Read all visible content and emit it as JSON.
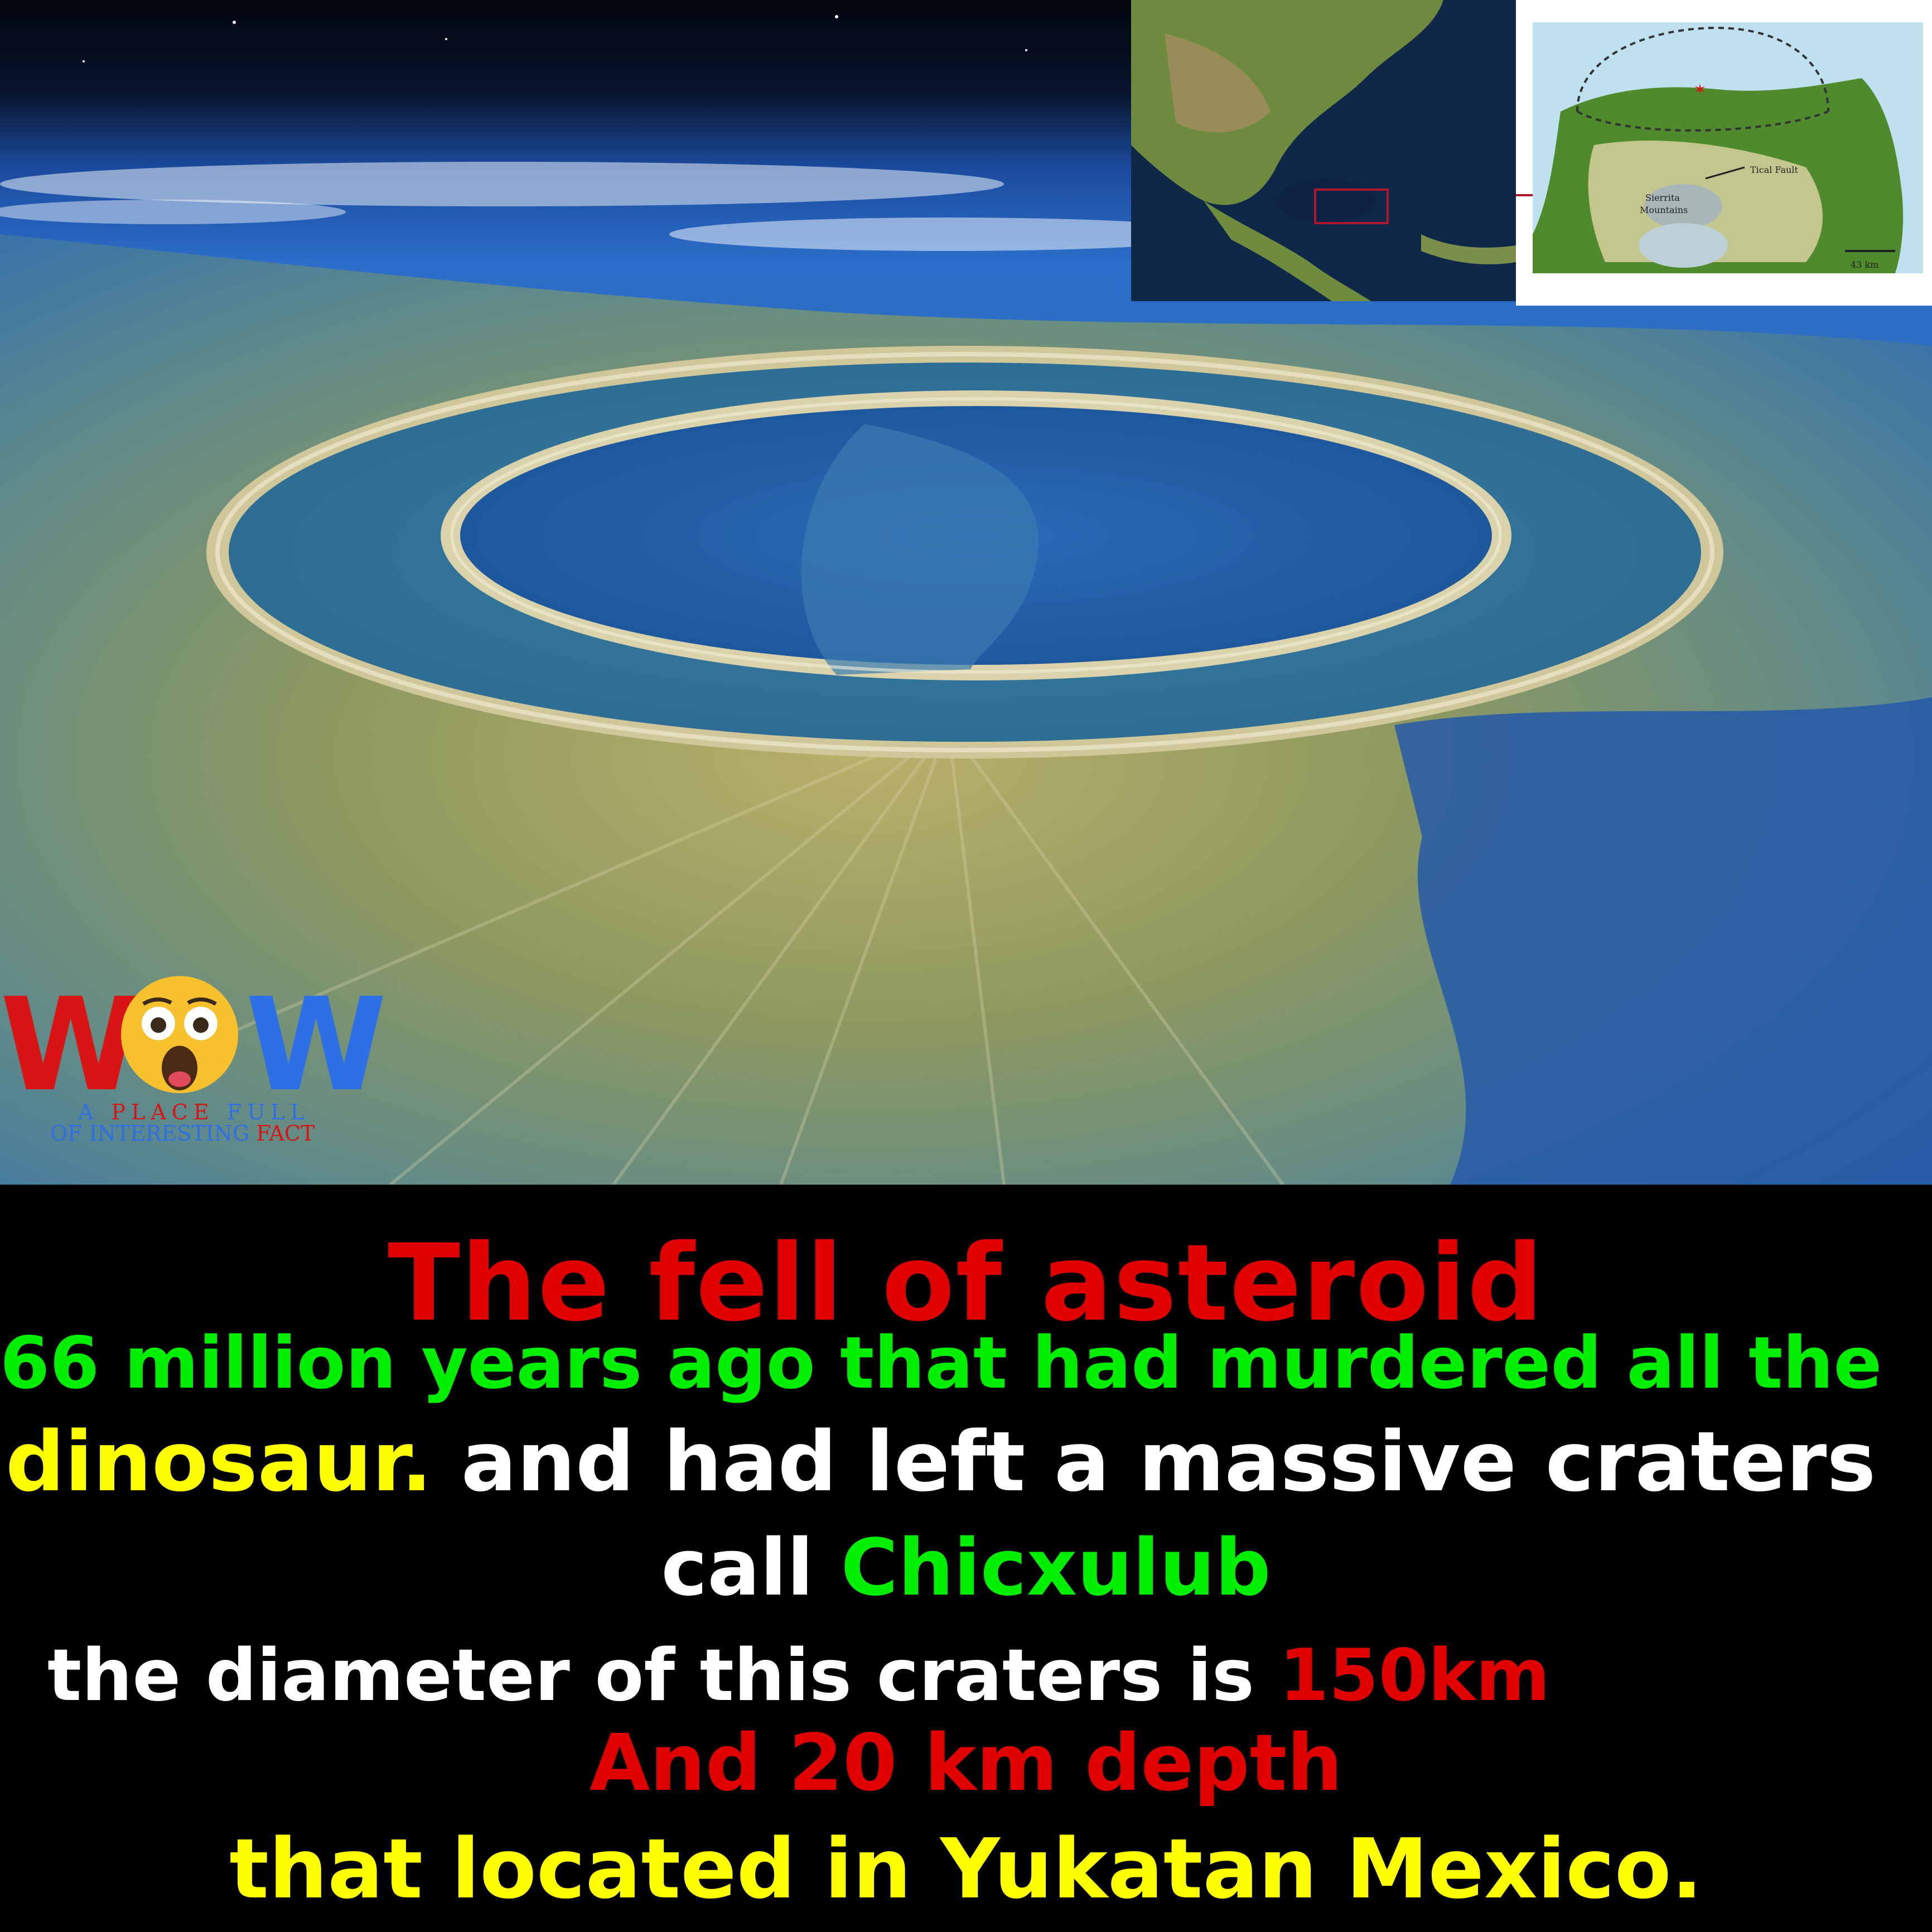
{
  "inset_map": {
    "label_fault": "Tical Fault",
    "label_sierrita": "Sierrita",
    "label_mountains": "Mountains",
    "scale_label": "43 km"
  },
  "logo": {
    "letter_left": "W",
    "letter_right": "W",
    "face_icon": "astonished-face-icon",
    "tagline_1_a": "A",
    "tagline_1_b": "PLACE",
    "tagline_1_c": "FULL",
    "tagline_2_a": "OF INTERESTING",
    "tagline_2_b": "FACT"
  },
  "caption": {
    "line1": "The fell of asteroid",
    "line2": "66 million years ago that had murdered all the",
    "line3_a": "dinosaur.",
    "line3_b": " and had left a massive craters",
    "line4_a": "call  ",
    "line4_b": "Chicxulub",
    "line5_a": "the diameter of this craters is  ",
    "line5_b": "150km",
    "line6": "And 20 km depth",
    "line7": "that located in Yukatan Mexico."
  },
  "colors": {
    "title_red": "#e00000",
    "green": "#00ee00",
    "yellow": "#ffff00",
    "white": "#ffffff",
    "logo_red": "#d81414",
    "logo_blue": "#2d6fe6"
  }
}
